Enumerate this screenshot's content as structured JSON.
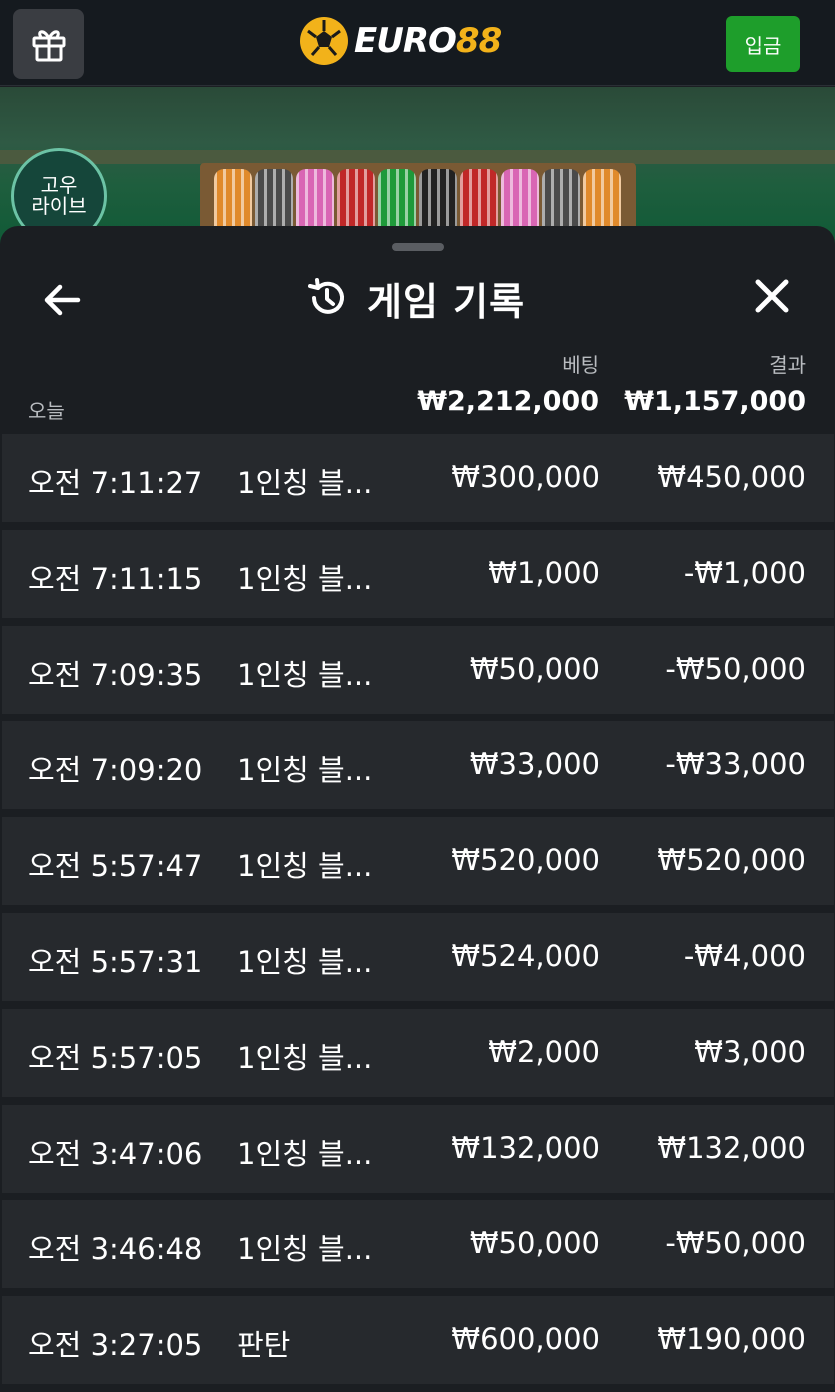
{
  "header": {
    "gift_icon": "gift-icon",
    "logo_text_white": "EURO",
    "logo_text_yellow": "88",
    "deposit_label": "입금",
    "colors": {
      "deposit": "#1e9e2b",
      "logo": "#f2b21a"
    }
  },
  "game_area": {
    "live_badge_line1": "고우",
    "live_badge_line2": "라이브"
  },
  "panel": {
    "title": "게임 기록",
    "title_icon": "history-icon",
    "back_icon": "arrow-left-icon",
    "close_icon": "close-icon",
    "summary": {
      "day_label": "오늘",
      "bet_header": "베팅",
      "result_header": "결과",
      "bet_total": "₩2,212,000",
      "result_total": "₩1,157,000"
    },
    "rows": [
      {
        "time": "오전 7:11:27",
        "game": "1인칭 블...",
        "bet": "₩300,000",
        "result": "₩450,000"
      },
      {
        "time": "오전 7:11:15",
        "game": "1인칭 블...",
        "bet": "₩1,000",
        "result": "-₩1,000"
      },
      {
        "time": "오전 7:09:35",
        "game": "1인칭 블...",
        "bet": "₩50,000",
        "result": "-₩50,000"
      },
      {
        "time": "오전 7:09:20",
        "game": "1인칭 블...",
        "bet": "₩33,000",
        "result": "-₩33,000"
      },
      {
        "time": "오전 5:57:47",
        "game": "1인칭 블...",
        "bet": "₩520,000",
        "result": "₩520,000"
      },
      {
        "time": "오전 5:57:31",
        "game": "1인칭 블...",
        "bet": "₩524,000",
        "result": "-₩4,000"
      },
      {
        "time": "오전 5:57:05",
        "game": "1인칭 블...",
        "bet": "₩2,000",
        "result": "₩3,000"
      },
      {
        "time": "오전 3:47:06",
        "game": "1인칭 블...",
        "bet": "₩132,000",
        "result": "₩132,000"
      },
      {
        "time": "오전 3:46:48",
        "game": "1인칭 블...",
        "bet": "₩50,000",
        "result": "-₩50,000"
      },
      {
        "time": "오전 3:27:05",
        "game": "판탄",
        "bet": "₩600,000",
        "result": "₩190,000"
      }
    ]
  }
}
